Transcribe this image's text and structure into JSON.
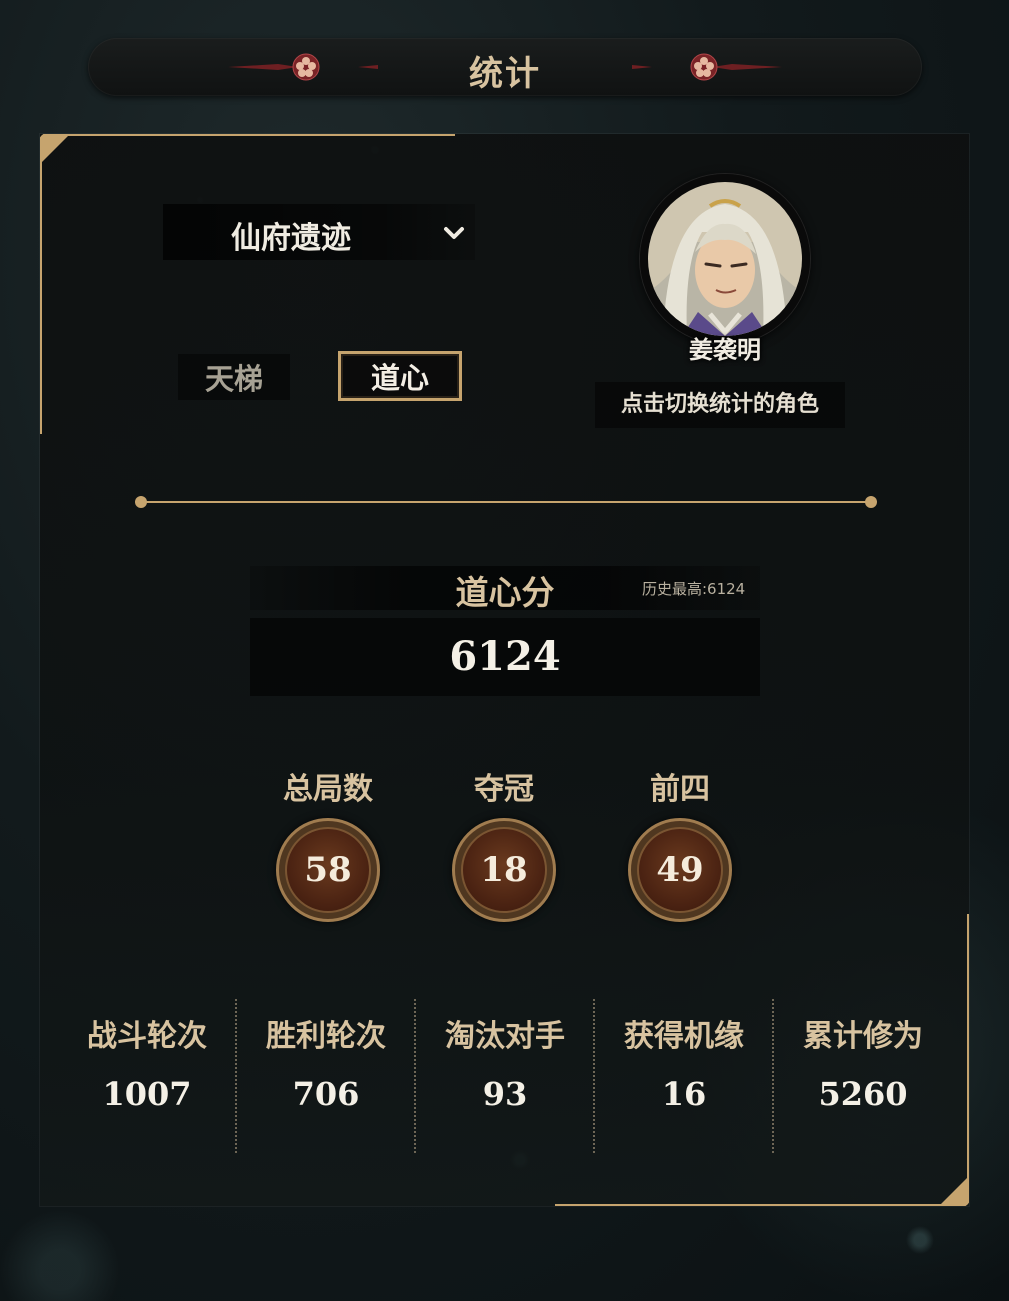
{
  "header": {
    "title": "统计"
  },
  "mode_selector": {
    "selected": "仙府遗迹"
  },
  "tabs": [
    {
      "label": "天梯",
      "active": false
    },
    {
      "label": "道心",
      "active": true
    }
  ],
  "character": {
    "name": "姜袭明",
    "switch_hint": "点击切换统计的角色"
  },
  "score": {
    "title": "道心分",
    "best": "历史最高:6124",
    "value": "6124"
  },
  "circle_stats": [
    {
      "label": "总局数",
      "value": "58"
    },
    {
      "label": "夺冠",
      "value": "18"
    },
    {
      "label": "前四",
      "value": "49"
    }
  ],
  "bottom_stats": [
    {
      "label": "战斗轮次",
      "value": "1007"
    },
    {
      "label": "胜利轮次",
      "value": "706"
    },
    {
      "label": "淘汰对手",
      "value": "93"
    },
    {
      "label": "获得机缘",
      "value": "16"
    },
    {
      "label": "累计修为",
      "value": "5260"
    }
  ],
  "colors": {
    "gold": "#c6a46e",
    "label_gold": "#d8c3a0",
    "orb_brown": "#4a2212",
    "ornament_red": "#8a2a2a"
  },
  "icons": {
    "dropdown": "chevron-down-icon",
    "ornament": "flower-ornament-icon"
  }
}
